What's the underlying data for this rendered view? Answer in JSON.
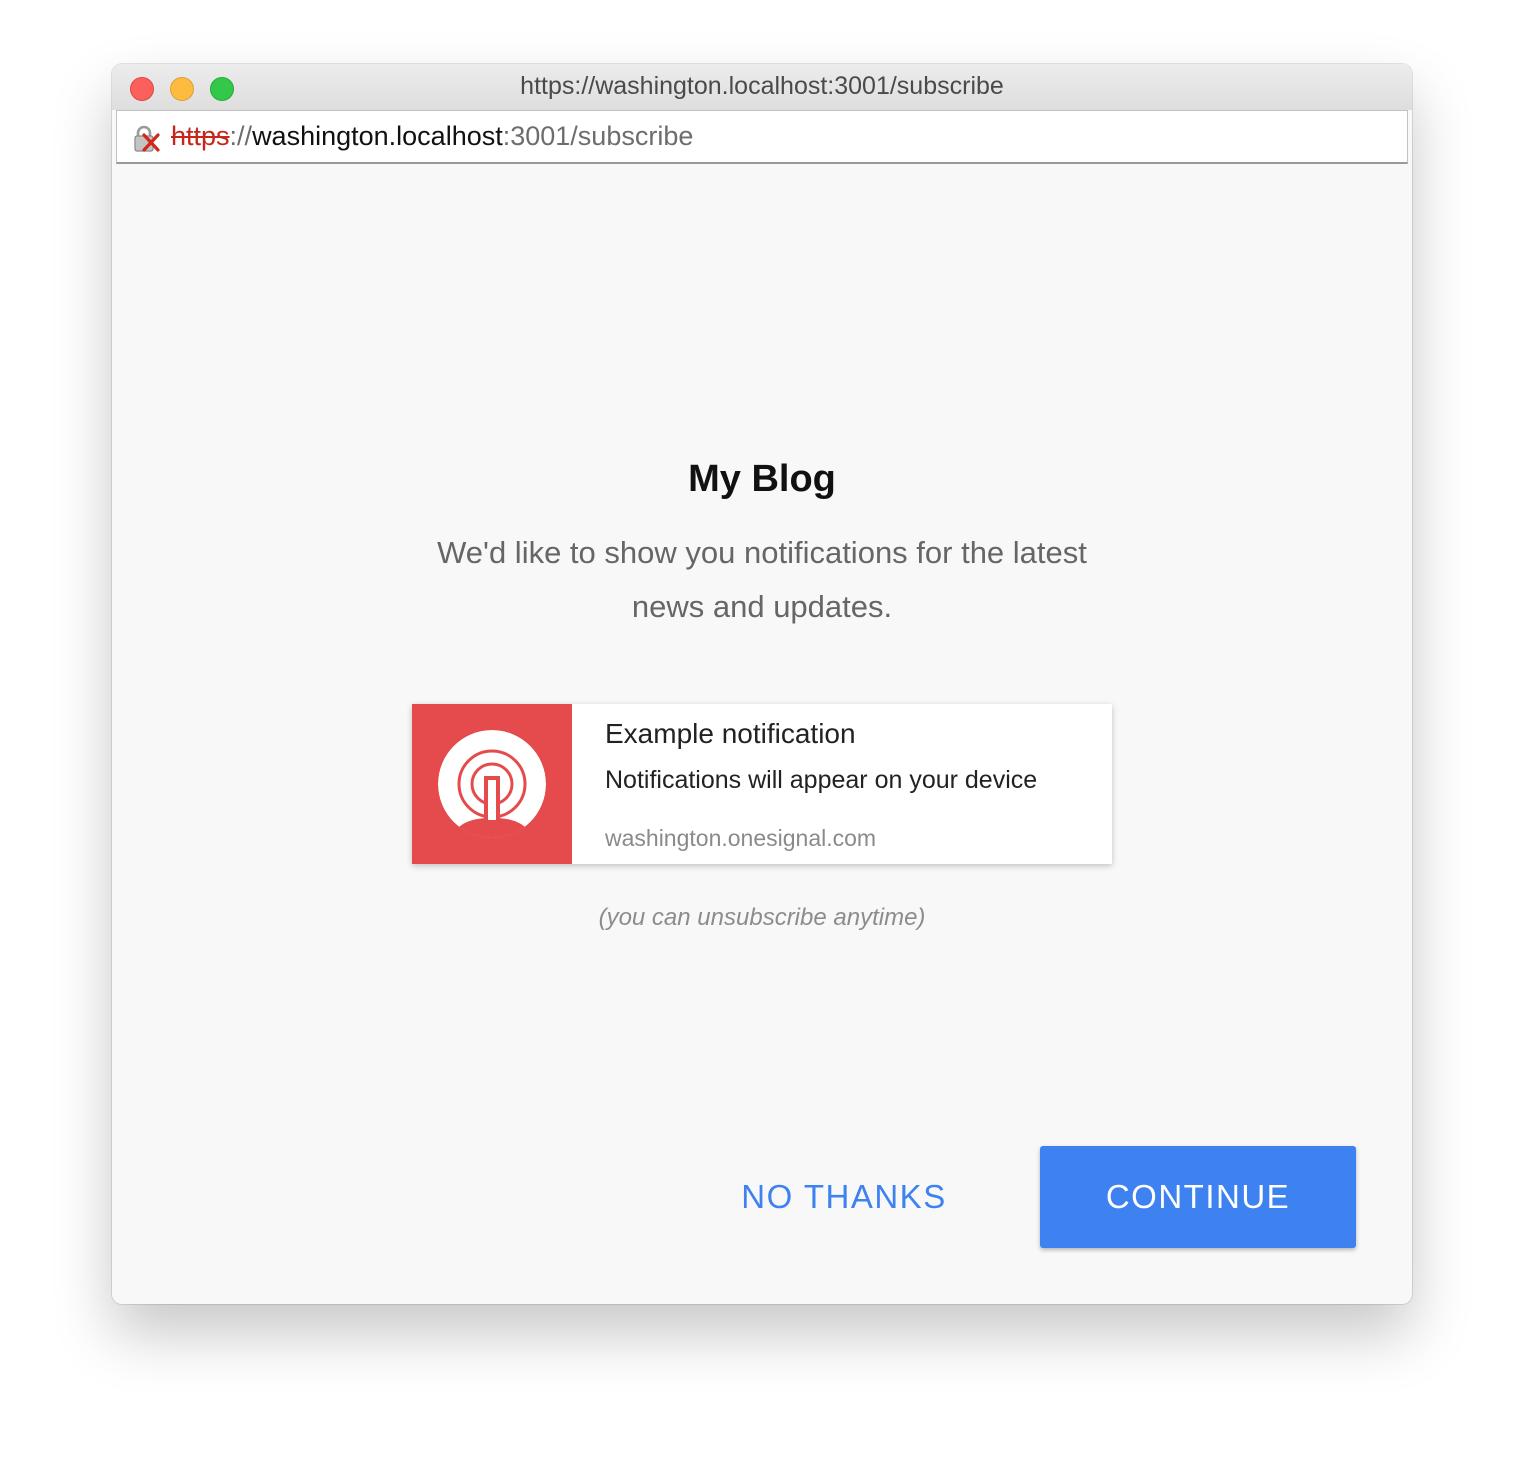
{
  "window": {
    "title": "https://washington.localhost:3001/subscribe"
  },
  "address_bar": {
    "scheme": "https",
    "separator": "://",
    "host": "washington.localhost",
    "rest": ":3001/subscribe",
    "security_icon": "insecure-lock-icon"
  },
  "prompt": {
    "site_name": "My Blog",
    "message": "We'd like to show you notifications for the latest news and updates.",
    "unsubscribe_note": "(you can unsubscribe anytime)"
  },
  "example_notification": {
    "title": "Example notification",
    "body": "Notifications will appear on your device",
    "domain": "washington.onesignal.com",
    "icon": "onesignal-logo-icon",
    "icon_background": "#e54b4d"
  },
  "buttons": {
    "no_thanks": "NO THANKS",
    "continue": "CONTINUE"
  },
  "colors": {
    "accent": "#3d82f0",
    "insecure_scheme": "#c5271a"
  }
}
